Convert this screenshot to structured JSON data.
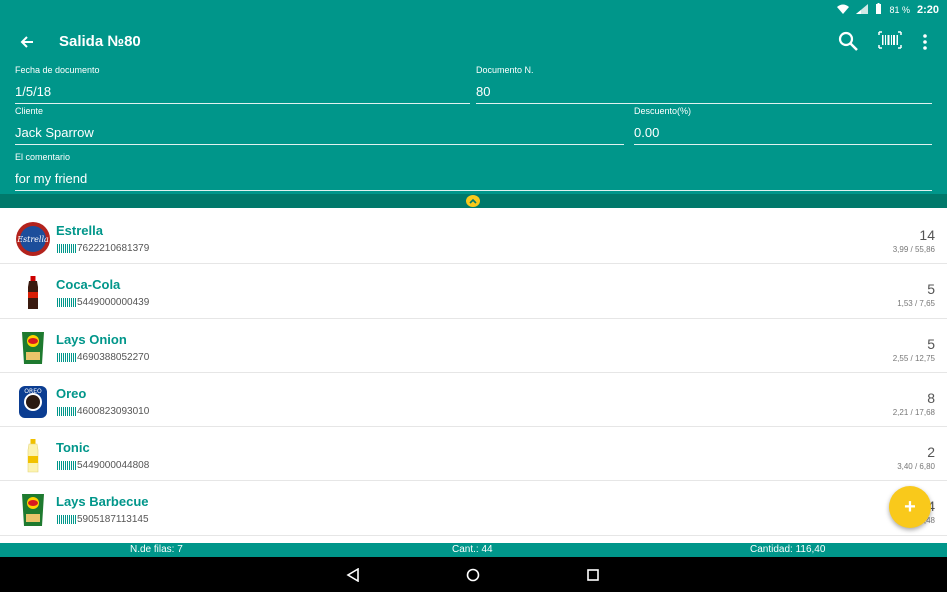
{
  "status_bar": {
    "battery": "81 %",
    "time": "2:20"
  },
  "toolbar": {
    "title": "Salida №80"
  },
  "form": {
    "date_label": "Fecha de documento",
    "date_value": "1/5/18",
    "docnum_label": "Documento N.",
    "docnum_value": "80",
    "client_label": "Cliente",
    "client_value": "Jack Sparrow",
    "discount_label": "Descuento(%)",
    "discount_value": "0.00",
    "comment_label": "El comentario",
    "comment_value": "for my friend"
  },
  "items": [
    {
      "name": "Estrella",
      "barcode": "7622210681379",
      "qty": "14",
      "price": "3,99 / 55,86",
      "icon": "beer-can-icon"
    },
    {
      "name": "Coca-Cola",
      "barcode": "5449000000439",
      "qty": "5",
      "price": "1,53 / 7,65",
      "icon": "cola-bottle-icon"
    },
    {
      "name": "Lays Onion",
      "barcode": "4690388052270",
      "qty": "5",
      "price": "2,55 / 12,75",
      "icon": "chips-bag-icon"
    },
    {
      "name": "Oreo",
      "barcode": "4600823093010",
      "qty": "8",
      "price": "2,21 / 17,68",
      "icon": "cookie-pack-icon"
    },
    {
      "name": "Tonic",
      "barcode": "5449000044808",
      "qty": "2",
      "price": "3,40 / 6,80",
      "icon": "tonic-bottle-icon"
    },
    {
      "name": "Lays Barbecue",
      "barcode": "5905187113145",
      "qty": "4",
      "price": "2,12 / 8,48",
      "icon": "chips-bag-icon"
    }
  ],
  "summary": {
    "rows": "N.de filas: 7",
    "cant": "Cant.: 44",
    "cantidad": "Cantidad: 116,40"
  },
  "fab": {
    "label": "+"
  },
  "colors": {
    "primary": "#00968a",
    "accent": "#f9c91b",
    "dark": "#00796b"
  }
}
